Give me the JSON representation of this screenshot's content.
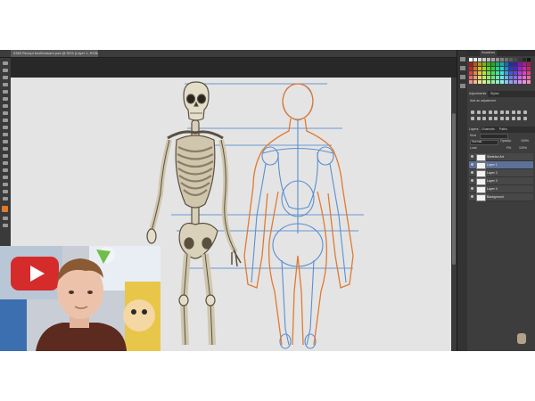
{
  "document": {
    "tab_title": "0365 Recept bestforskare.psd @ 50% (Layer 1, RGB/8) *"
  },
  "panels": {
    "swatches_tab": "Swatches",
    "adjustments_tab": "Adjustments",
    "styles_tab": "Styles",
    "add_adjustment_label": "Add an adjustment",
    "layers_tab": "Layers",
    "channels_tab": "Channels",
    "paths_tab": "Paths",
    "kind_label": "Kind",
    "blend_mode": "Normal",
    "opacity_label": "Opacity:",
    "opacity_value": "100%",
    "lock_label": "Lock:",
    "fill_label": "Fill:",
    "fill_value": "100%",
    "layers": [
      {
        "name": "Skeleton Art",
        "selected": false
      },
      {
        "name": "Layer 1",
        "selected": true
      },
      {
        "name": "Layer 2",
        "selected": false
      },
      {
        "name": "Layer 3",
        "selected": false
      },
      {
        "name": "Layer 4",
        "selected": false
      },
      {
        "name": "Background",
        "selected": false
      }
    ]
  },
  "colors": {
    "construction_blue": "#5b8fd0",
    "construction_orange": "#e07a32",
    "bone": "#e3ddca",
    "bone_shadow": "#5a5040",
    "selected_layer": "#5c7197",
    "youtube_red": "#d62b2b"
  },
  "icons": [
    "move-tool-icon",
    "marquee-tool-icon",
    "lasso-tool-icon",
    "brush-tool-icon",
    "eraser-tool-icon",
    "zoom-tool-icon",
    "eye-icon",
    "logo-icon"
  ]
}
